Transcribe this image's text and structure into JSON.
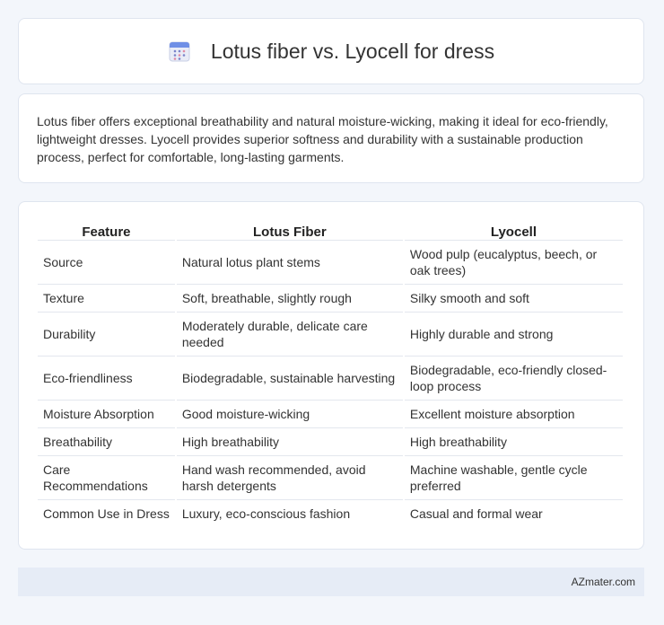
{
  "header": {
    "title": "Lotus fiber vs. Lyocell for dress",
    "icon": "calendar-icon"
  },
  "summary": {
    "text": "Lotus fiber offers exceptional breathability and natural moisture-wicking, making it ideal for eco-friendly, lightweight dresses. Lyocell provides superior softness and durability with a sustainable production process, perfect for comfortable, long-lasting garments."
  },
  "table": {
    "headers": [
      "Feature",
      "Lotus Fiber",
      "Lyocell"
    ],
    "rows": [
      [
        "Source",
        "Natural lotus plant stems",
        "Wood pulp (eucalyptus, beech, or oak trees)"
      ],
      [
        "Texture",
        "Soft, breathable, slightly rough",
        "Silky smooth and soft"
      ],
      [
        "Durability",
        "Moderately durable, delicate care needed",
        "Highly durable and strong"
      ],
      [
        "Eco-friendliness",
        "Biodegradable, sustainable harvesting",
        "Biodegradable, eco-friendly closed-loop process"
      ],
      [
        "Moisture Absorption",
        "Good moisture-wicking",
        "Excellent moisture absorption"
      ],
      [
        "Breathability",
        "High breathability",
        "High breathability"
      ],
      [
        "Care Recommendations",
        "Hand wash recommended, avoid harsh detergents",
        "Machine washable, gentle cycle preferred"
      ],
      [
        "Common Use in Dress",
        "Luxury, eco-conscious fashion",
        "Casual and formal wear"
      ]
    ]
  },
  "footer": {
    "brand": "AZmater.com"
  }
}
